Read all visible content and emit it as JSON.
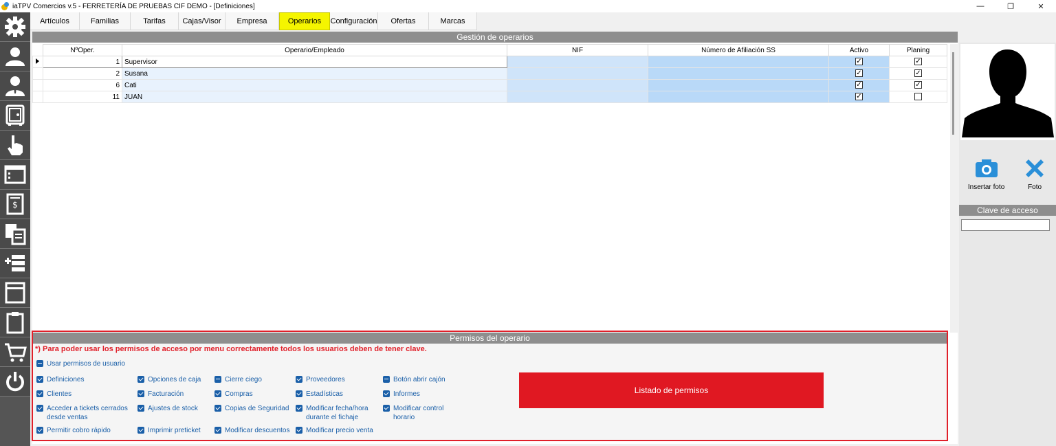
{
  "window": {
    "title": "iaTPV Comercios v.5 - FERRETERÍA DE PRUEBAS CIF DEMO - [Definiciones]",
    "minimize": "—",
    "restore": "❐",
    "close": "✕"
  },
  "tabs": [
    {
      "label": "Artículos",
      "active": false
    },
    {
      "label": "Familias",
      "active": false
    },
    {
      "label": "Tarifas",
      "active": false
    },
    {
      "label": "Cajas/Visor",
      "active": false
    },
    {
      "label": "Empresa",
      "active": false
    },
    {
      "label": "Operarios",
      "active": true
    },
    {
      "label": "Configuración",
      "active": false
    },
    {
      "label": "Ofertas",
      "active": false
    },
    {
      "label": "Marcas",
      "active": false
    }
  ],
  "operators": {
    "header": "Gestión de operarios",
    "columns": [
      "NºOper.",
      "Operario/Empleado",
      "NIF",
      "Número de Afiliación SS",
      "Activo",
      "Planing"
    ],
    "rows": [
      {
        "num": "1",
        "name": "Supervisor",
        "nif": "",
        "ss": "",
        "activo": true,
        "planing": true
      },
      {
        "num": "2",
        "name": "Susana",
        "nif": "",
        "ss": "",
        "activo": true,
        "planing": true
      },
      {
        "num": "6",
        "name": "Cati",
        "nif": "",
        "ss": "",
        "activo": true,
        "planing": true
      },
      {
        "num": "11",
        "name": "JUAN",
        "nif": "",
        "ss": "",
        "activo": true,
        "planing": false
      }
    ]
  },
  "permissions": {
    "header": "Permisos del operario",
    "note": "*) Para poder usar los permisos de acceso por menu correctamente todos los usuarios deben de tener clave.",
    "use_user_perms": "Usar permisos de usuario",
    "col1": [
      "Definiciones",
      "Clientes",
      "Acceder a tickets cerrados desde ventas",
      "Permitir cobro rápido"
    ],
    "col2": [
      "Opciones de caja",
      "Facturación",
      "Ajustes de stock",
      "Imprimir preticket"
    ],
    "col3": [
      "Cierre ciego",
      "Compras",
      "Copias de Seguridad",
      "Modificar descuentos"
    ],
    "col4": [
      "Proveedores",
      "Estadísticas",
      "Modificar fecha/hora durante el fichaje",
      "Modificar precio venta"
    ],
    "col5": [
      "Botón abrir cajón",
      "Informes",
      "Modificar control horario"
    ],
    "list_button": "Listado de permisos"
  },
  "right_panel": {
    "insert_photo": "Insertar foto",
    "delete_photo": "Foto",
    "password_header": "Clave de acceso",
    "password_value": ""
  },
  "colors": {
    "active_tab": "#f5f500",
    "accent_red": "#e01822",
    "perm_blue": "#1a5fa8",
    "photo_action_blue": "#2a8fd8"
  }
}
